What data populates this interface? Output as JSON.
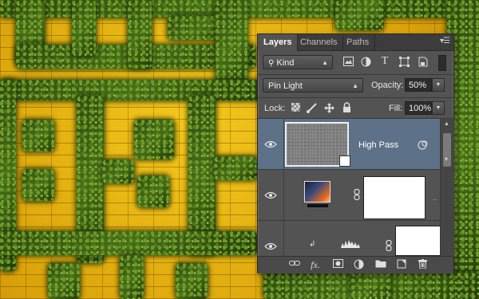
{
  "panel": {
    "tabs": [
      {
        "label": "Layers"
      },
      {
        "label": "Channels"
      },
      {
        "label": "Paths"
      }
    ],
    "menu_icon": "panel-menu-icon",
    "filter": {
      "kind_label": "Kind",
      "icons": [
        "pixel-filter-icon",
        "adjustment-filter-icon",
        "type-filter-icon",
        "shape-filter-icon",
        "smart-object-filter-icon"
      ]
    },
    "blend_mode": "Pin Light",
    "opacity_label": "Opacity:",
    "opacity_value": "50%",
    "lock_label": "Lock:",
    "fill_label": "Fill:",
    "fill_value": "100%",
    "layers": [
      {
        "name": "High Pass",
        "selected": true
      },
      {
        "name": "",
        "selected": false
      },
      {
        "name": "",
        "selected": false
      }
    ],
    "footer_icons": [
      "link-layers-icon",
      "layer-style-icon",
      "add-mask-icon",
      "adjustment-layer-icon",
      "new-group-icon",
      "new-layer-icon",
      "delete-layer-icon"
    ]
  },
  "colors": {
    "panel_bg": "#535353",
    "selected_layer": "#5d7289",
    "brick_yellow": "#e5b40c",
    "grass_green": "#466d17"
  }
}
